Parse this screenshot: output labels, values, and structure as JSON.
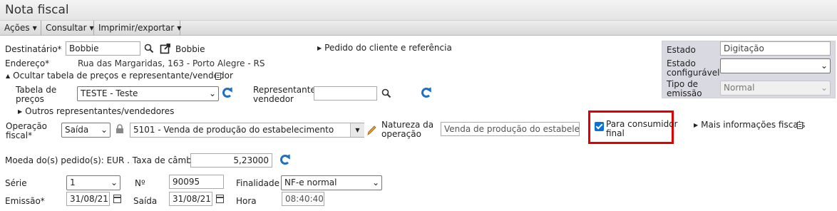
{
  "window": {
    "title": "Nota fiscal"
  },
  "menubar": [
    {
      "label": "Ações"
    },
    {
      "label": "Consultar"
    },
    {
      "label": "Imprimir/exportar"
    }
  ],
  "destinatario": {
    "label": "Destinatário*",
    "value": "Bobbie",
    "link_text": "Bobbie",
    "endereco_label": "Endereço*",
    "endereco_value": "Rua das Margaridas, 163 - Porto Alegre - RS"
  },
  "pedido_link": "Pedido do cliente e referência",
  "toggle_tabela": "Ocultar tabela de preços e representante/vendedor",
  "tabela_precos": {
    "label": "Tabela de\npreços",
    "value": "TESTE - Teste"
  },
  "representante": {
    "label": "Representante/\nvendedor",
    "value": ""
  },
  "outros_representantes": "Outros representantes/vendedores",
  "operacao": {
    "label": "Operação\nfiscal*",
    "tipo": "Saída",
    "cfop": "5101 - Venda de produção do estabelecimento"
  },
  "natureza": {
    "label": "Natureza da\noperação",
    "value": "Venda de produção do estabelecimento"
  },
  "consumidor_final": {
    "label": "Para consumidor\nfinal",
    "checked": true
  },
  "mais_info": "Mais informações fiscais",
  "moeda": {
    "label": "Moeda do(s) pedido(s): EUR . Taxa de câmbio:",
    "taxa": "5,23000"
  },
  "serie": {
    "label": "Série",
    "value": "1"
  },
  "numero": {
    "label": "Nº",
    "value": "90095"
  },
  "finalidade": {
    "label": "Finalidade",
    "value": "NF-e normal"
  },
  "emissao": {
    "label": "Emissão*",
    "value": "31/08/21"
  },
  "saida": {
    "label": "Saída",
    "value": "31/08/21"
  },
  "hora": {
    "label": "Hora",
    "value": "08:40:40"
  },
  "estado_panel": {
    "estado_label": "Estado",
    "estado_value": "Digitação",
    "configuravel_label": "Estado\nconfigurável",
    "configuravel_value": "",
    "tipo_emissao_label": "Tipo de\nemissão",
    "tipo_emissao_value": "Normal"
  },
  "colors": {
    "accent": "#1e6fc8",
    "highlight": "#e00000",
    "panel": "#d9d9e2"
  }
}
